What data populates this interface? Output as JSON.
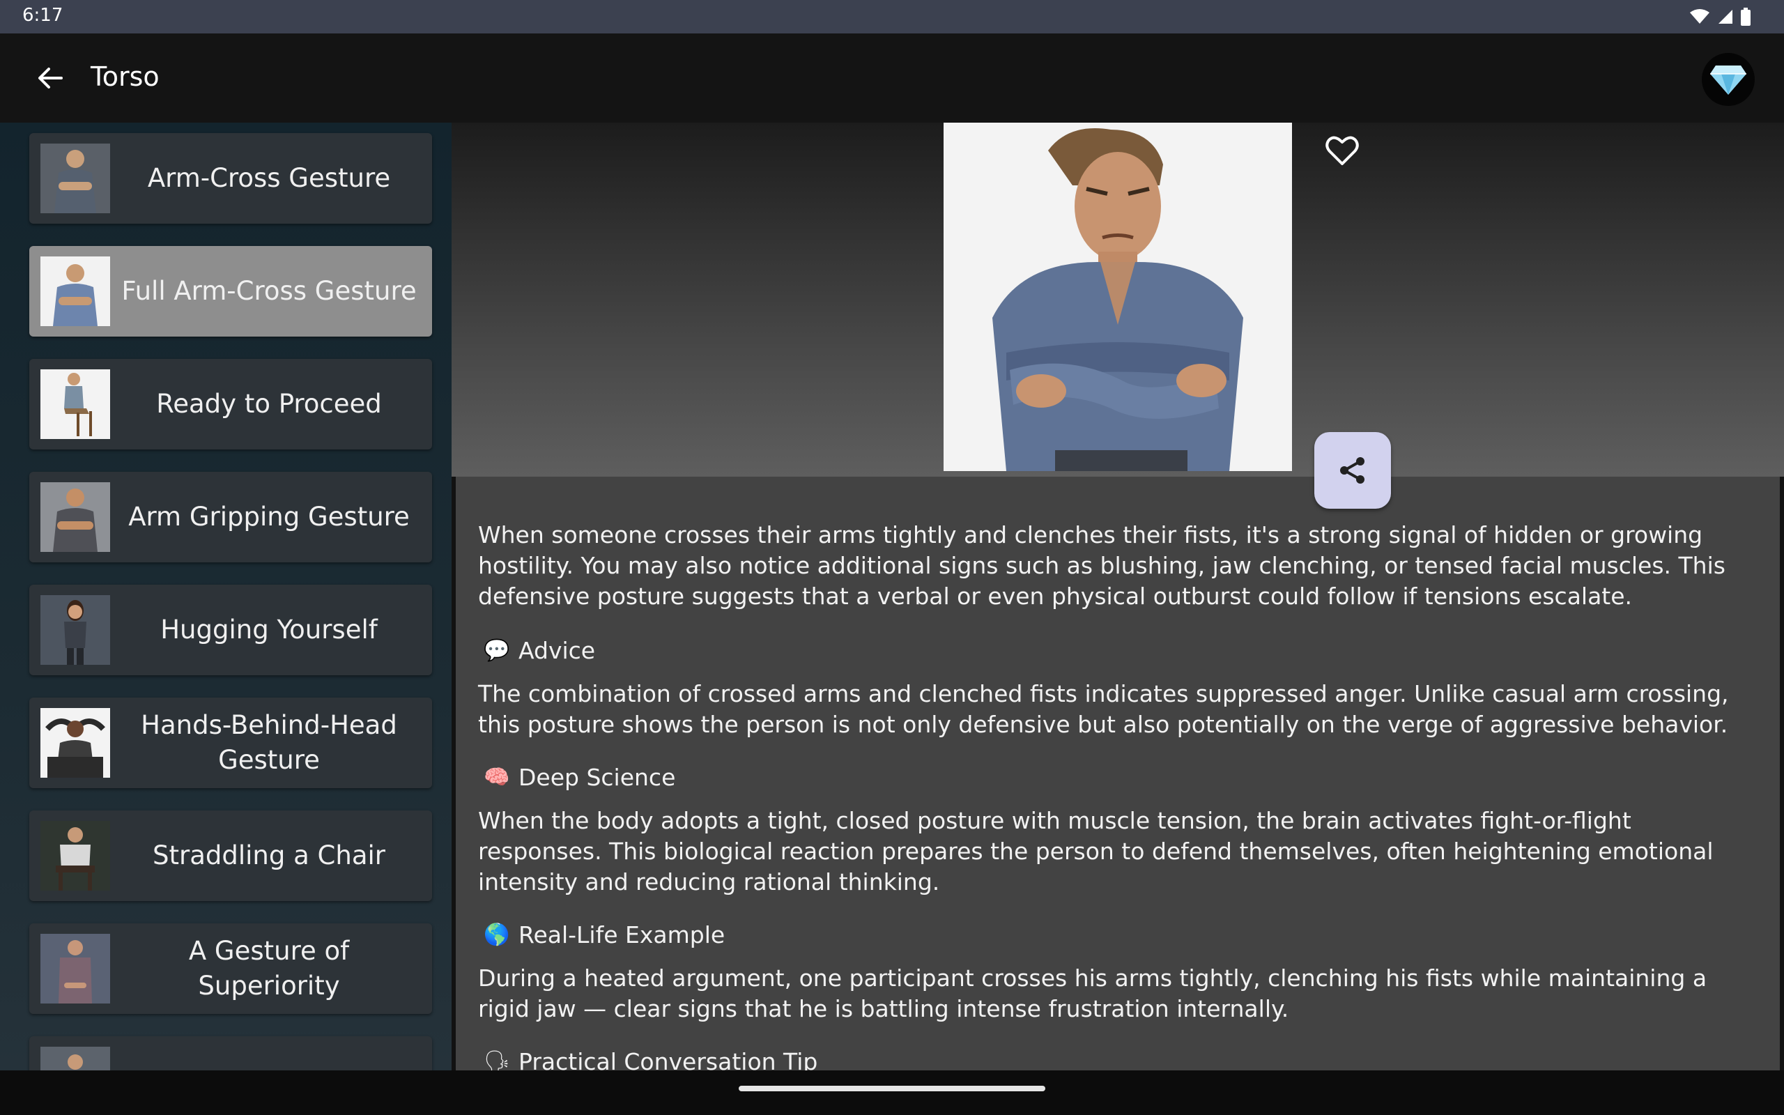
{
  "status": {
    "time": "6:17"
  },
  "appbar": {
    "title": "Torso"
  },
  "sidebar": {
    "items": [
      {
        "label": "Arm-Cross Gesture",
        "selected": false
      },
      {
        "label": "Full Arm-Cross Gesture",
        "selected": true
      },
      {
        "label": "Ready to Proceed",
        "selected": false
      },
      {
        "label": "Arm Gripping Gesture",
        "selected": false
      },
      {
        "label": "Hugging Yourself",
        "selected": false
      },
      {
        "label": "Hands-Behind-Head Gesture",
        "selected": false
      },
      {
        "label": "Straddling a Chair",
        "selected": false
      },
      {
        "label": "A Gesture of Superiority",
        "selected": false
      },
      {
        "label": "",
        "selected": false
      }
    ]
  },
  "detail": {
    "intro": "When someone crosses their arms tightly and clenches their fists, it's a strong signal of hidden or growing hostility. You may also notice additional signs such as blushing, jaw clenching, or tensed facial muscles. This defensive posture suggests that a verbal or even physical outburst could follow if tensions escalate.",
    "sections": [
      {
        "icon": "💬",
        "title": "Advice",
        "body": "The combination of crossed arms and clenched fists indicates suppressed anger. Unlike casual arm crossing, this posture shows the person is not only defensive but also potentially on the verge of aggressive behavior."
      },
      {
        "icon": "🧠",
        "title": "Deep Science",
        "body": "When the body adopts a tight, closed posture with muscle tension, the brain activates fight-or-flight responses. This biological reaction prepares the person to defend themselves, often heightening emotional intensity and reducing rational thinking."
      },
      {
        "icon": "🌎",
        "title": "Real-Life Example",
        "body": "During a heated argument, one participant crosses his arms tightly, clenching his fists while maintaining a rigid jaw — clear signs that he is battling intense frustration internally."
      },
      {
        "icon": "🗣",
        "title": "Practical Conversation Tip"
      }
    ]
  },
  "icons": {
    "back": "arrow-back-icon",
    "premium": "diamond-icon",
    "favorite": "heart-outline-icon",
    "share": "share-icon"
  }
}
